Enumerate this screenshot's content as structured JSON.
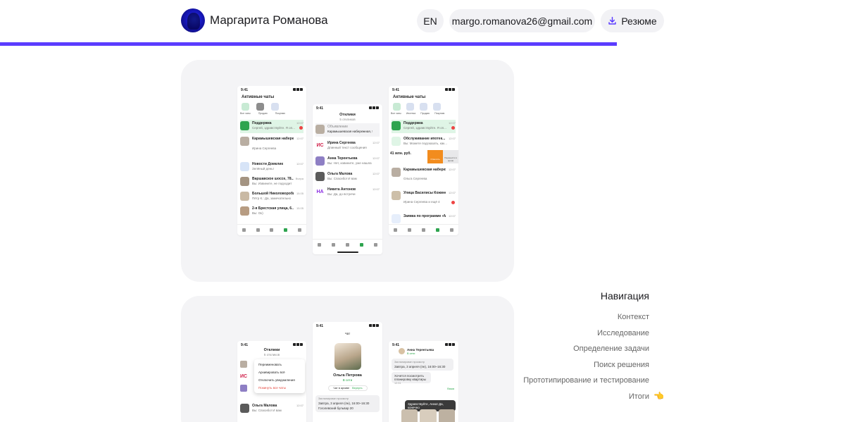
{
  "header": {
    "name": "Маргарита Романова",
    "lang": "EN",
    "email": "margo.romanova26@gmail.com",
    "resume": "Резюме"
  },
  "progress": {
    "percent": 73
  },
  "colors": {
    "accent": "#5b3cff",
    "card": "#f4f4f6",
    "pill": "#f2f2f5",
    "hand": "#f0b13a"
  },
  "icons": {
    "resume": "download-icon",
    "nav_pointer": "pointing-hand-icon"
  },
  "card1": {
    "phone1": {
      "time": "9:41",
      "title": "Активные чаты",
      "chips": [
        "Все чаты",
        "Продаю",
        "Покупаю"
      ],
      "rows": [
        {
          "title": "Поддержка",
          "text": "Сергей, здравствуйте. Я оп...",
          "time": "12:07"
        },
        {
          "title": "Карамышевская набережная, 5...",
          "text": "Ирина Сергеева",
          "time": "12:07"
        },
        {
          "title": "Новости Домклик",
          "text": "Зелёный день!",
          "time": "12:07"
        },
        {
          "title": "Варшавское шоссе, 78...",
          "text": "Вы: Извините, не подходит",
          "time": "Вчера"
        },
        {
          "title": "Большой Николоворобин...",
          "text": "Пётр К.: Да, замечательно",
          "time": "15.05"
        },
        {
          "title": "2-я Брестская улица, 6...",
          "text": "Вы: Ок)",
          "time": "15.05"
        }
      ],
      "tabs": [
        "Главная",
        "Поиск",
        "Избранное",
        "Чаты",
        "Кабинет"
      ]
    },
    "phone2": {
      "time": "9:41",
      "title": "Отклики",
      "subtitle": "5 откликов",
      "rows": [
        {
          "title": "Объявление",
          "text": "Карамышевская набережная, 56...",
          "time": ""
        },
        {
          "title": "Ирина Сергеева",
          "text": "Длинный текст сообщения",
          "time": "12:07",
          "initials": "ИС"
        },
        {
          "title": "Анна Терентьева",
          "text": "Вы: Нет, извините, уже нашла",
          "time": "12:07"
        },
        {
          "title": "Ольга Малова",
          "text": "Вы: Спасибо! И вам",
          "time": "12:07"
        },
        {
          "title": "Никита Антонов",
          "text": "Вы: Да, до встречи",
          "time": "12:07",
          "initials": "НА"
        }
      ]
    },
    "phone3": {
      "time": "9:41",
      "title": "Активные чаты",
      "chips": [
        "Все чаты",
        "Ипотека",
        "Продаю",
        "Покупаю"
      ],
      "rows": [
        {
          "title": "Поддержка",
          "text": "Сергей, здравствуйте. Я оп...",
          "time": "12:07"
        },
        {
          "title": "Обслуживание ипотек...",
          "text": "Вы: Можете подсказать, как...",
          "time": "12:07"
        },
        {
          "title": "41 млн. руб.",
          "text": "",
          "time": ""
        },
        {
          "title": "Карамышевская набережная, 5...",
          "text": "Ольга Сергеева",
          "time": "12:07"
        },
        {
          "title": "Улица Василисы Кожиной,...",
          "text": "Ирина Сергеева и ещё 4",
          "time": "12:07"
        },
        {
          "title": "Заявка по программе «М...",
          "text": "",
          "time": "12:07"
        }
      ],
      "swipe": [
        "Отметить",
        "Перенести в архив"
      ]
    }
  },
  "card2": {
    "phone1": {
      "time": "9:41",
      "title": "Отклики",
      "subtitle": "5 откликов",
      "menu": [
        "Переименовать",
        "Архивировать всё",
        "Отключить уведомления",
        "Покинуть все чаты"
      ],
      "rows": [
        {
          "title": "Ольга Малова",
          "text": "Вы: Спасибо! И вам",
          "time": "12:07"
        }
      ]
    },
    "phone2": {
      "time": "9:41",
      "title": "Чат",
      "person": "Ольга Петрова",
      "status": "В сети",
      "archive": "Чат в архиве",
      "restore": "Вернуть",
      "meeting_label": "Запланирован просмотр",
      "meeting_time": "Завтра, 3 апреля (пн), 16:00–16:30",
      "meeting_place": "Гоголевский бульвар 20"
    },
    "phone3": {
      "time": "9:41",
      "person": "Анна Терентьева",
      "status": "В сети",
      "meeting_label": "Запланирован просмотр",
      "meeting_time": "Завтра, 3 апреля (пн), 16:00–16:30",
      "msg1": "Хочется посмотреть планировку квартиры",
      "msg2": "Здравствуйте, Анна! Да, конечно",
      "time_mark": "12:31",
      "read": "Ваша"
    }
  },
  "nav": {
    "title": "Навигация",
    "items": [
      "Контекст",
      "Исследование",
      "Определение задачи",
      "Поиск решения",
      "Прототипирование и тестирование",
      "Итоги"
    ]
  }
}
